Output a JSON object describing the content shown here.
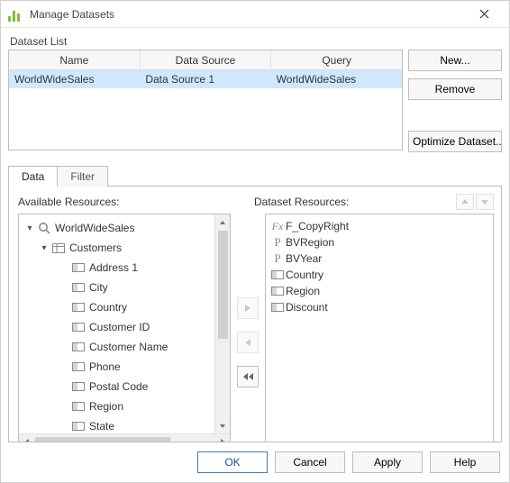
{
  "window": {
    "title": "Manage Datasets"
  },
  "datasetList": {
    "label": "Dataset List",
    "columns": [
      "Name",
      "Data Source",
      "Query"
    ],
    "rows": [
      {
        "name": "WorldWideSales",
        "dataSource": "Data Source 1",
        "query": "WorldWideSales",
        "selected": true
      }
    ]
  },
  "sideButtons": {
    "new": "New...",
    "remove": "Remove",
    "optimize": "Optimize Dataset..."
  },
  "tabs": {
    "data": "Data",
    "filter": "Filter",
    "active": "data"
  },
  "available": {
    "label": "Available Resources:",
    "root": "WorldWideSales",
    "group": "Customers",
    "items": [
      "Address 1",
      "City",
      "Country",
      "Customer ID",
      "Customer Name",
      "Phone",
      "Postal Code",
      "Region",
      "State"
    ]
  },
  "datasetRes": {
    "label": "Dataset Resources:",
    "items": [
      {
        "icon": "fx",
        "label": "F_CopyRight"
      },
      {
        "icon": "param",
        "label": "BVRegion"
      },
      {
        "icon": "param",
        "label": "BVYear"
      },
      {
        "icon": "field",
        "label": "Country"
      },
      {
        "icon": "field",
        "label": "Region"
      },
      {
        "icon": "field",
        "label": "Discount"
      }
    ]
  },
  "footer": {
    "ok": "OK",
    "cancel": "Cancel",
    "apply": "Apply",
    "help": "Help"
  }
}
